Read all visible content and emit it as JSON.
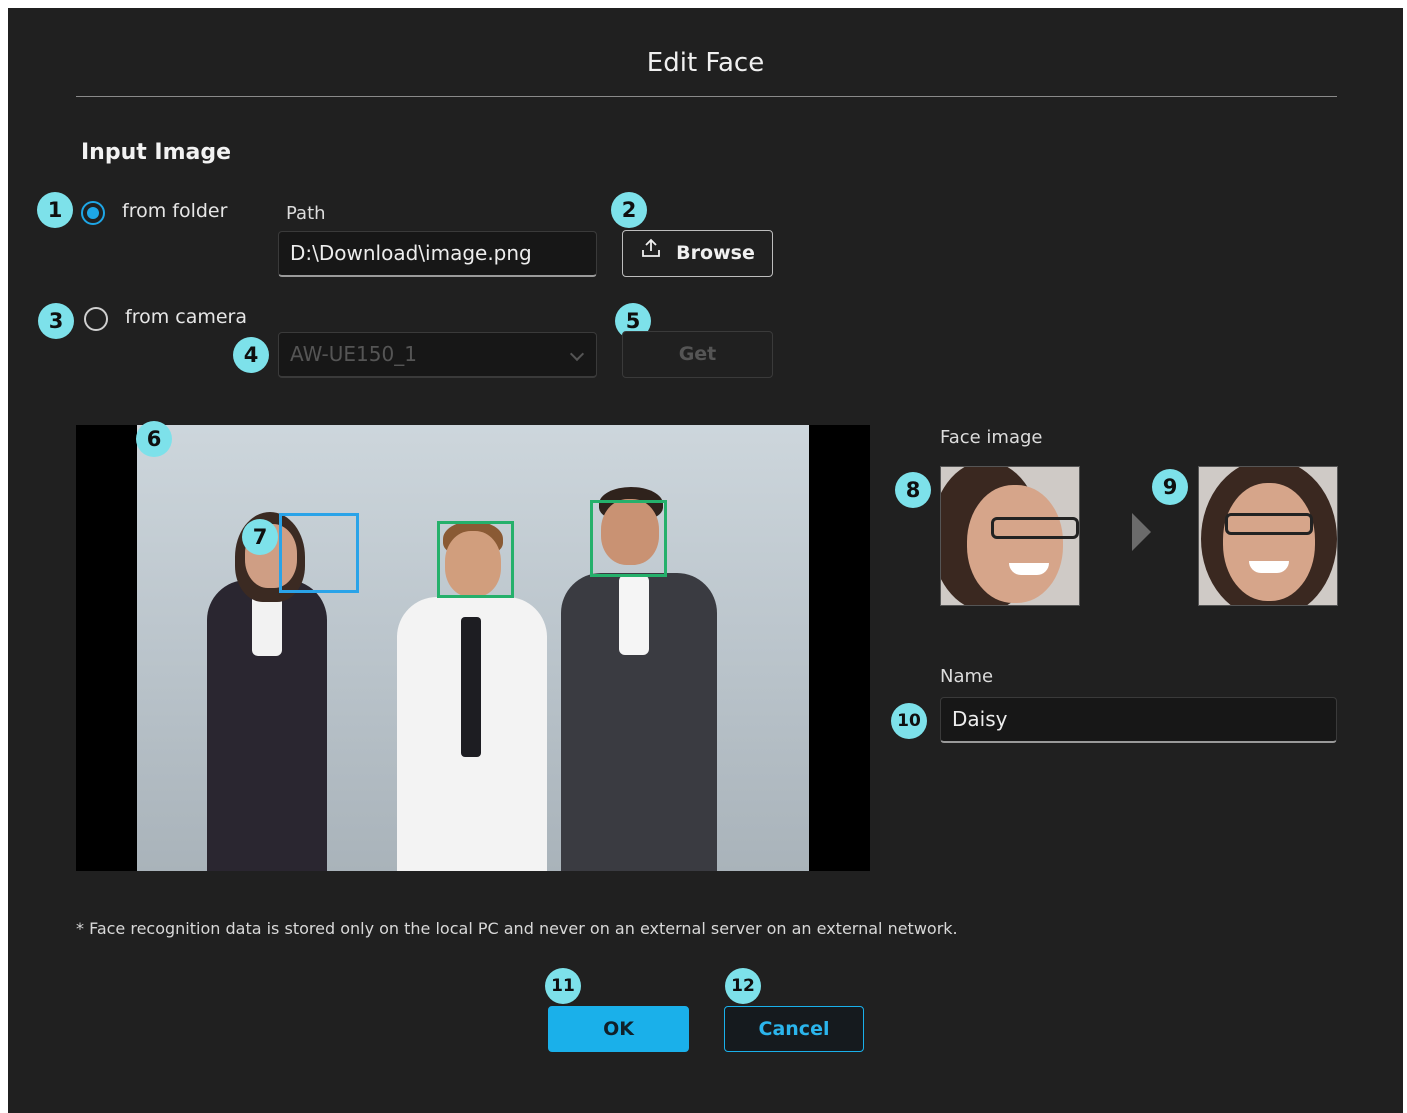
{
  "dialog": {
    "title": "Edit Face"
  },
  "input_section": {
    "title": "Input Image",
    "folder_option": {
      "label": "from folder",
      "selected": true
    },
    "path_label": "Path",
    "path_value": "D:\\Download\\image.png",
    "browse_label": "Browse",
    "camera_option": {
      "label": "from camera",
      "selected": false
    },
    "camera_select_value": "AW-UE150_1",
    "get_label": "Get"
  },
  "face_panel": {
    "face_image_label": "Face image",
    "name_label": "Name",
    "name_value": "Daisy"
  },
  "footnote": "* Face recognition data is stored only on the local PC and never on an external server on an external network.",
  "buttons": {
    "ok_label": "OK",
    "cancel_label": "Cancel"
  },
  "badges": [
    "1",
    "2",
    "3",
    "4",
    "5",
    "6",
    "7",
    "8",
    "9",
    "10",
    "11",
    "12"
  ],
  "colors": {
    "accent": "#1ab0ea",
    "badge": "#7de1ea",
    "background": "#202020",
    "face_box": "#25b06b",
    "face_box_selected": "#2aa3e8"
  },
  "icons": {
    "browse": "upload-icon",
    "dropdown": "chevron-down-icon",
    "transfer": "arrow-right-icon"
  }
}
